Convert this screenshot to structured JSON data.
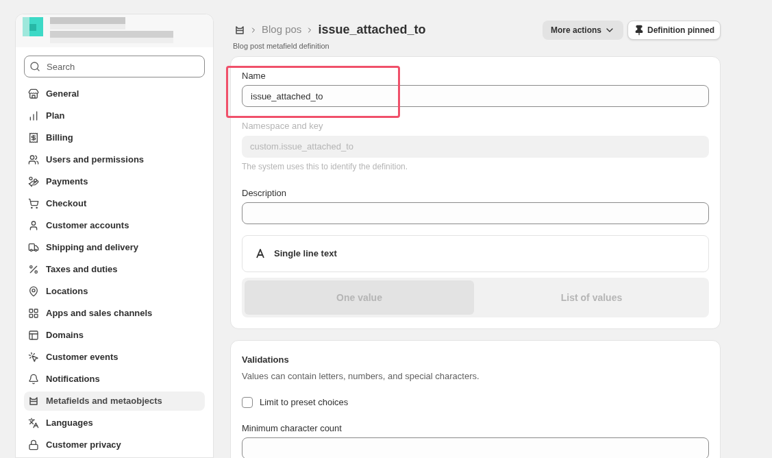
{
  "sidebar": {
    "search": {
      "placeholder": "Search"
    },
    "items": [
      {
        "label": "General",
        "selected": false
      },
      {
        "label": "Plan",
        "selected": false
      },
      {
        "label": "Billing",
        "selected": false
      },
      {
        "label": "Users and permissions",
        "selected": false
      },
      {
        "label": "Payments",
        "selected": false
      },
      {
        "label": "Checkout",
        "selected": false
      },
      {
        "label": "Customer accounts",
        "selected": false
      },
      {
        "label": "Shipping and delivery",
        "selected": false
      },
      {
        "label": "Taxes and duties",
        "selected": false
      },
      {
        "label": "Locations",
        "selected": false
      },
      {
        "label": "Apps and sales channels",
        "selected": false
      },
      {
        "label": "Domains",
        "selected": false
      },
      {
        "label": "Customer events",
        "selected": false
      },
      {
        "label": "Notifications",
        "selected": false
      },
      {
        "label": "Metafields and metaobjects",
        "selected": true
      },
      {
        "label": "Languages",
        "selected": false
      },
      {
        "label": "Customer privacy",
        "selected": false
      }
    ]
  },
  "header": {
    "breadcrumb": [
      "Blog pos"
    ],
    "title": "issue_attached_to",
    "subtitle": "Blog post metafield definition",
    "buttons": [
      {
        "label": "More actions",
        "kind": "menu"
      },
      {
        "label": "Definition pinned",
        "kind": "pin"
      }
    ]
  },
  "definition": {
    "name": {
      "label": "Name",
      "value": "issue_attached_to"
    },
    "namespace": {
      "label": "Namespace and key",
      "value": "custom.issue_attached_to",
      "help": "The system uses this to identify the definition.",
      "disabled": true
    },
    "description": {
      "label": "Description"
    },
    "type": {
      "label": "Single line text"
    },
    "cardinality": {
      "disabled": true,
      "options": [
        {
          "label": "One value",
          "selected": true
        },
        {
          "label": "List of values",
          "selected": false
        }
      ]
    }
  },
  "validations": {
    "title": "Validations",
    "subtitle": "Values can contain letters, numbers, and special characters.",
    "limit": {
      "label": "Limit to preset choices",
      "checked": false
    },
    "min_count": {
      "label": "Minimum character count"
    }
  }
}
